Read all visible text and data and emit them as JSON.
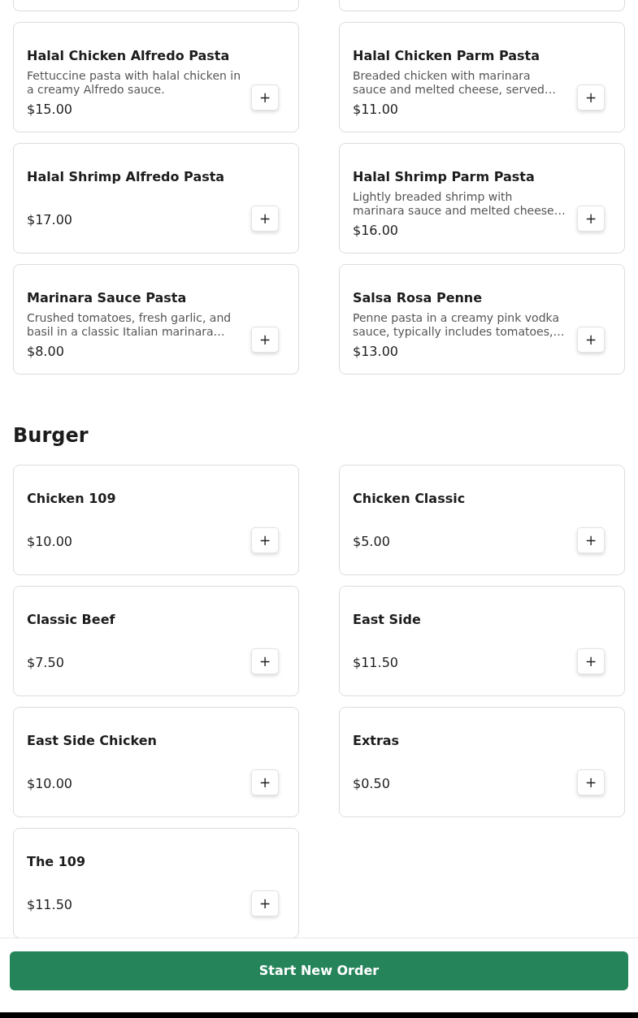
{
  "sections": [
    {
      "items": [
        {
          "name": "Halal Chicken Alfredo Pasta",
          "description": "Fettuccine pasta with halal chicken in a creamy Alfredo sauce.",
          "price": "$15.00",
          "add_button": "+"
        },
        {
          "name": "Halal Chicken Parm Pasta",
          "description": "Breaded chicken with marinara sauce and melted cheese, served…",
          "price": "$11.00",
          "add_button": "+"
        },
        {
          "name": "Halal Shrimp Alfredo Pasta",
          "price": "$17.00",
          "add_button": "+"
        },
        {
          "name": "Halal Shrimp Parm Pasta",
          "description": "Lightly breaded shrimp with marinara sauce and melted cheese…",
          "price": "$16.00",
          "add_button": "+"
        },
        {
          "name": "Marinara Sauce Pasta",
          "description": "Crushed tomatoes, fresh garlic, and basil in a classic Italian marinara…",
          "price": "$8.00",
          "add_button": "+"
        },
        {
          "name": "Salsa Rosa Penne",
          "description": "Penne pasta in a creamy pink vodka sauce, typically includes tomatoes,…",
          "price": "$13.00",
          "add_button": "+"
        }
      ]
    },
    {
      "title": "Burger",
      "items": [
        {
          "name": "Chicken 109",
          "price": "$10.00",
          "add_button": "+"
        },
        {
          "name": "Chicken Classic",
          "price": "$5.00",
          "add_button": "+"
        },
        {
          "name": "Classic Beef",
          "price": "$7.50",
          "add_button": "+"
        },
        {
          "name": "East Side",
          "price": "$11.50",
          "add_button": "+"
        },
        {
          "name": "East Side Chicken",
          "price": "$10.00",
          "add_button": "+"
        },
        {
          "name": "Extras",
          "price": "$0.50",
          "add_button": "+"
        },
        {
          "name": "The 109",
          "price": "$11.50",
          "add_button": "+"
        }
      ]
    }
  ],
  "footer_button": "Start New Order"
}
